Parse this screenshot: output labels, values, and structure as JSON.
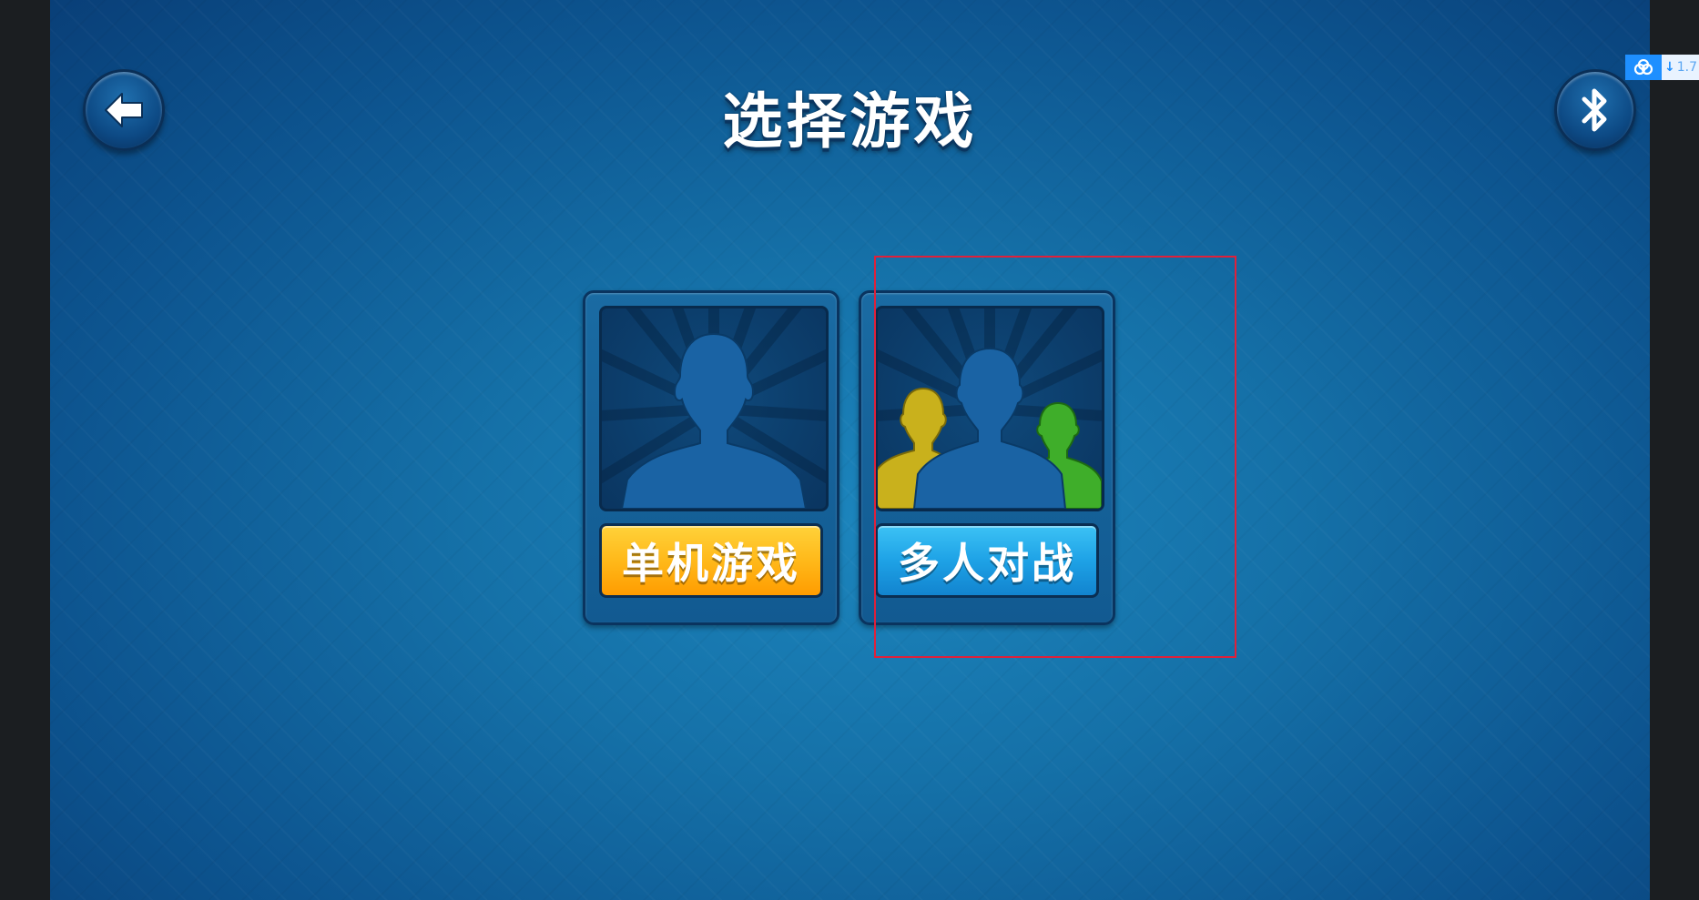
{
  "header": {
    "title": "选择游戏",
    "back_icon": "back-arrow-icon",
    "bluetooth_icon": "bluetooth-icon"
  },
  "modes": [
    {
      "label": "单机游戏",
      "icon": "single-player-silhouette-icon",
      "button_color": "#ffb01a"
    },
    {
      "label": "多人对战",
      "icon": "multiplayer-silhouettes-icon",
      "button_color": "#1ea2e6"
    }
  ],
  "overlay": {
    "icon": "cloud-link-icon",
    "value": "1.7",
    "arrow": "↓"
  },
  "colors": {
    "background": "#1571a8",
    "highlight": "#e0203a"
  }
}
